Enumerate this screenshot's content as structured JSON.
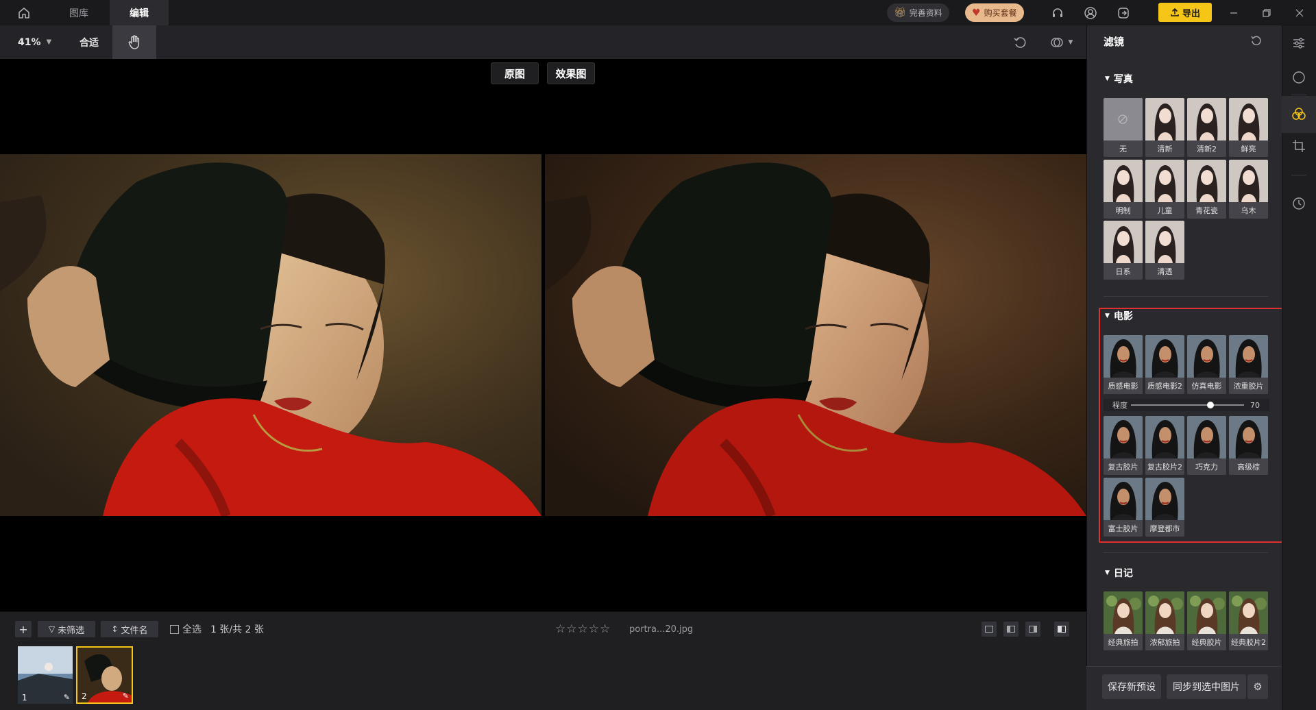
{
  "titlebar": {
    "tabs": [
      {
        "label": "图库",
        "active": false
      },
      {
        "label": "编辑",
        "active": true
      }
    ],
    "complete_profile": "完善资料",
    "buy_package": "购买套餐",
    "export_label": "导出"
  },
  "toolbar": {
    "zoom": "41%",
    "fit": "合适"
  },
  "canvas": {
    "original_label": "原图",
    "effect_label": "效果图"
  },
  "bottombar": {
    "filter_label": "未筛选",
    "sort_label": "文件名",
    "select_all_label": "全选",
    "count_label": "1 张/共 2 张",
    "filename": "portra...20.jpg",
    "rating_stars": "☆☆☆☆☆",
    "thumbnails": [
      {
        "number": "1",
        "selected": false
      },
      {
        "number": "2",
        "selected": true
      }
    ]
  },
  "panel": {
    "title": "滤镜",
    "sections": [
      {
        "title": "写真",
        "items": [
          "无",
          "清新",
          "清新2",
          "鲜亮",
          "明制",
          "儿童",
          "青花瓷",
          "乌木",
          "日系",
          "清透"
        ]
      },
      {
        "title": "电影",
        "items": [
          "质感电影",
          "质感电影2",
          "仿真电影",
          "浓重胶片",
          "复古胶片",
          "复古胶片2",
          "巧克力",
          "高级棕",
          "富士胶片",
          "摩登都市"
        ],
        "selected": "质感电影",
        "strength_label": "程度",
        "strength_value": "70",
        "strength_fraction": 0.7
      },
      {
        "title": "日记",
        "items": [
          "经典旅拍",
          "浓郁旅拍",
          "经典胶片",
          "经典胶片2"
        ]
      }
    ],
    "save_preset": "保存新预设",
    "sync_selected": "同步到选中图片"
  },
  "colors": {
    "accent": "#f5c518",
    "highlight_box": "#e03030"
  }
}
